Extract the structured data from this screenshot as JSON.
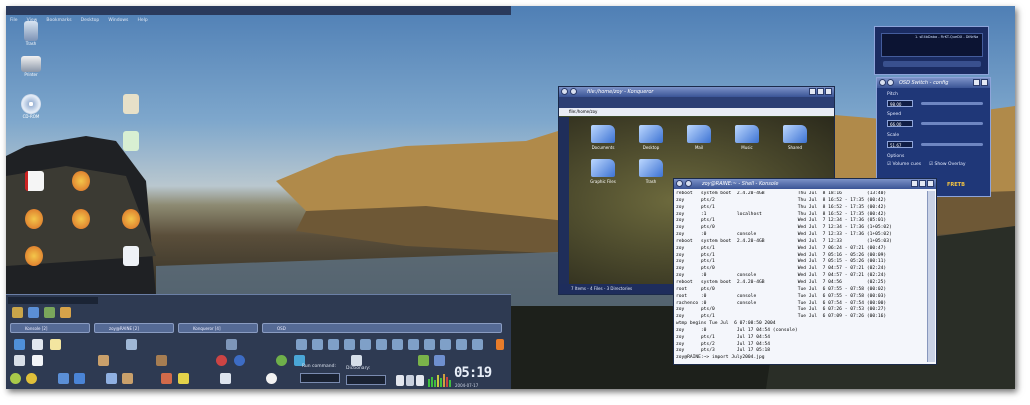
{
  "menubar": {
    "items": [
      "File",
      "View",
      "Bookmarks",
      "Desktop",
      "Windows",
      "Help"
    ]
  },
  "desktop_icons": [
    {
      "name": "trash-icon",
      "label": "Trash"
    },
    {
      "name": "printer-icon",
      "label": "Printer"
    },
    {
      "name": "cdrom-icon",
      "label": "CD-ROM"
    }
  ],
  "konqueror": {
    "title": "file:/home/zoy - Konqueror",
    "location": "file:/home/zoy",
    "items": [
      "Documents",
      "Desktop",
      "Mail",
      "Music",
      "Shared",
      "Graphic Files",
      "Trash"
    ],
    "statusbar": "7 Items - 4 Files - 3 Directories"
  },
  "osd": {
    "title": "OSD Switch - config",
    "labels": {
      "pitch": "Pitch",
      "speed": "Speed",
      "scale": "Scale",
      "options": "Options"
    },
    "values": {
      "pitch": "98.00",
      "speed": "66.00",
      "scale": "51.67"
    },
    "checkboxes": {
      "volume": "Volume cues",
      "overlay": "Show Overlay"
    },
    "brand": "FRETB"
  },
  "player": {
    "track": "1. sE4bDaba - FirKT-QueDX - DiNrNa"
  },
  "terminal": {
    "title": "zoy@RAINE:~ - Shell - Konsole",
    "lines": [
      "reboot   system boot  2.4.20-4GB            Thu Jul  8 18:16         (13:40)",
      "zoy      pts/2                              Thu Jul  8 16:52 - 17:35 (00:42)",
      "zoy      pts/1                              Thu Jul  8 16:52 - 17:35 (00:42)",
      "zoy      :1           localhost             Thu Jul  8 16:52 - 17:35 (00:42)",
      "zoy      pts/1                              Wed Jul  7 12:34 - 17:36 (05:01)",
      "zoy      pts/0                              Wed Jul  7 12:34 - 17:36 (1+05:02)",
      "zoy      :0           console               Wed Jul  7 12:33 - 17:36 (1+05:02)",
      "reboot   system boot  2.4.20-4GB            Wed Jul  7 12:33         (1+05:03)",
      "zoy      pts/1                              Wed Jul  7 06:24 - 07:21 (00:47)",
      "zoy      pts/1                              Wed Jul  7 05:16 - 05:26 (00:09)",
      "zoy      pts/1                              Wed Jul  7 05:15 - 05:26 (00:11)",
      "zoy      pts/0                              Wed Jul  7 04:57 - 07:21 (02:24)",
      "zoy      :0           console               Wed Jul  7 04:57 - 07:21 (02:24)",
      "reboot   system boot  2.4.20-4GB            Wed Jul  7 04:56         (02:25)",
      "root     pts/0                              Tue Jul  6 07:55 - 07:58 (00:02)",
      "root     :0           console               Tue Jul  6 07:55 - 07:58 (00:03)",
      "rachenco :0           console               Tue Jul  6 07:54 - 07:54 (00:00)",
      "zoy      pts/0                              Tue Jul  6 07:26 - 07:53 (00:27)",
      "zoy      pts/1                              Tue Jul  6 07:09 - 07:26 (00:16)",
      "",
      "wtmp begins Tue Jul  6 07:08:50 2004",
      "zoy      :0           Jul 17 04:54 (console)",
      "zoy      pts/1        Jul 17 04:54",
      "zoy      pts/2        Jul 17 04:54",
      "zoy      pts/3        Jul 17 05:18",
      "zoy@RAINE:~> import July2004.jpg"
    ]
  },
  "panel": {
    "taskbar": [
      "Konsole [2]",
      "zoy@RAINE [2]",
      "Konqueror [4]",
      "OSD"
    ],
    "run_command_label": "Run command:",
    "dictionary_label": "Dictionary:",
    "clock": "05:19",
    "date": "2004-07-17"
  }
}
